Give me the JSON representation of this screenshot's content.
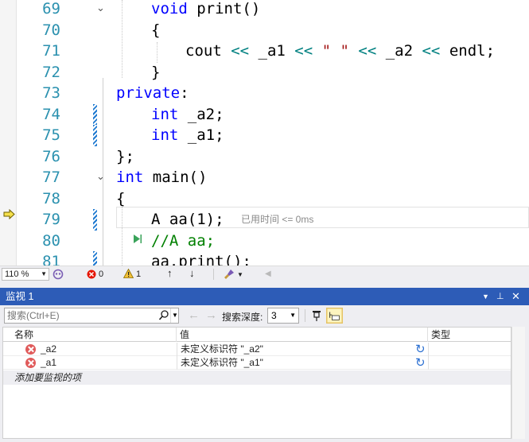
{
  "editor": {
    "lines": [
      {
        "num": "69",
        "fold": "⌄",
        "tokens": [
          {
            "t": "void",
            "c": "kw"
          },
          {
            "t": " print()",
            "c": "tx"
          }
        ],
        "indent": 190
      },
      {
        "num": "70",
        "tokens": [
          {
            "t": "{",
            "c": "tx"
          }
        ],
        "indent": 190
      },
      {
        "num": "71",
        "tokens": [
          {
            "t": "cout ",
            "c": "tx"
          },
          {
            "t": "<<",
            "c": "op"
          },
          {
            "t": " _a1 ",
            "c": "tx"
          },
          {
            "t": "<<",
            "c": "op"
          },
          {
            "t": " \" \" ",
            "c": "st"
          },
          {
            "t": "<<",
            "c": "op"
          },
          {
            "t": " _a2 ",
            "c": "tx"
          },
          {
            "t": "<<",
            "c": "op"
          },
          {
            "t": " endl;",
            "c": "tx"
          }
        ],
        "indent": 233
      },
      {
        "num": "72",
        "tokens": [
          {
            "t": "}",
            "c": "tx"
          }
        ],
        "indent": 190
      },
      {
        "num": "73",
        "tokens": [
          {
            "t": "private",
            "c": "kw"
          },
          {
            "t": ":",
            "c": "tx"
          }
        ],
        "indent": 146
      },
      {
        "num": "74",
        "change": true,
        "tokens": [
          {
            "t": "int",
            "c": "kw"
          },
          {
            "t": " _a2;",
            "c": "tx"
          }
        ],
        "indent": 190
      },
      {
        "num": "75",
        "change": true,
        "tokens": [
          {
            "t": "int",
            "c": "kw"
          },
          {
            "t": " _a1;",
            "c": "tx"
          }
        ],
        "indent": 190
      },
      {
        "num": "76",
        "tokens": [
          {
            "t": "};",
            "c": "tx"
          }
        ],
        "indent": 146
      },
      {
        "num": "77",
        "fold": "⌄",
        "tokens": [
          {
            "t": "int",
            "c": "kw"
          },
          {
            "t": " main()",
            "c": "tx"
          }
        ],
        "indent": 146
      },
      {
        "num": "78",
        "tokens": [
          {
            "t": "{",
            "c": "tx"
          }
        ],
        "indent": 146
      },
      {
        "num": "79",
        "change": true,
        "tokens": [
          {
            "t": "A aa(1);",
            "c": "tx"
          }
        ],
        "indent": 190
      },
      {
        "num": "80",
        "tokens": [
          {
            "t": "//A aa;",
            "c": "cm"
          }
        ],
        "indent": 190
      },
      {
        "num": "81",
        "change": true,
        "tokens": [
          {
            "t": "aa.print();",
            "c": "tx"
          }
        ],
        "indent": 190
      }
    ],
    "elapsed": "已用时间 <= 0ms",
    "next_statement_icon": "next-statement-arrow-icon",
    "run_to_click_icon": "run-to-click-icon"
  },
  "status_bar": {
    "zoom": "110 %",
    "errors": "0",
    "warnings": "1"
  },
  "watch": {
    "title": "监视 1",
    "search_placeholder": "搜索(Ctrl+E)",
    "depth_label": "搜索深度:",
    "depth_value": "3",
    "columns": {
      "name": "名称",
      "value": "值",
      "type": "类型"
    },
    "rows": [
      {
        "name": "_a2",
        "value": "未定义标识符 \"_a2\"",
        "type": ""
      },
      {
        "name": "_a1",
        "value": "未定义标识符 \"_a1\"",
        "type": ""
      }
    ],
    "add_item": "添加要监视的项"
  },
  "colors": {
    "keyword": "#0000ff",
    "string": "#a31515",
    "comment": "#008000",
    "line_number": "#2b91af",
    "title_bar": "#2d5cb7",
    "error": "#e05a5a"
  }
}
